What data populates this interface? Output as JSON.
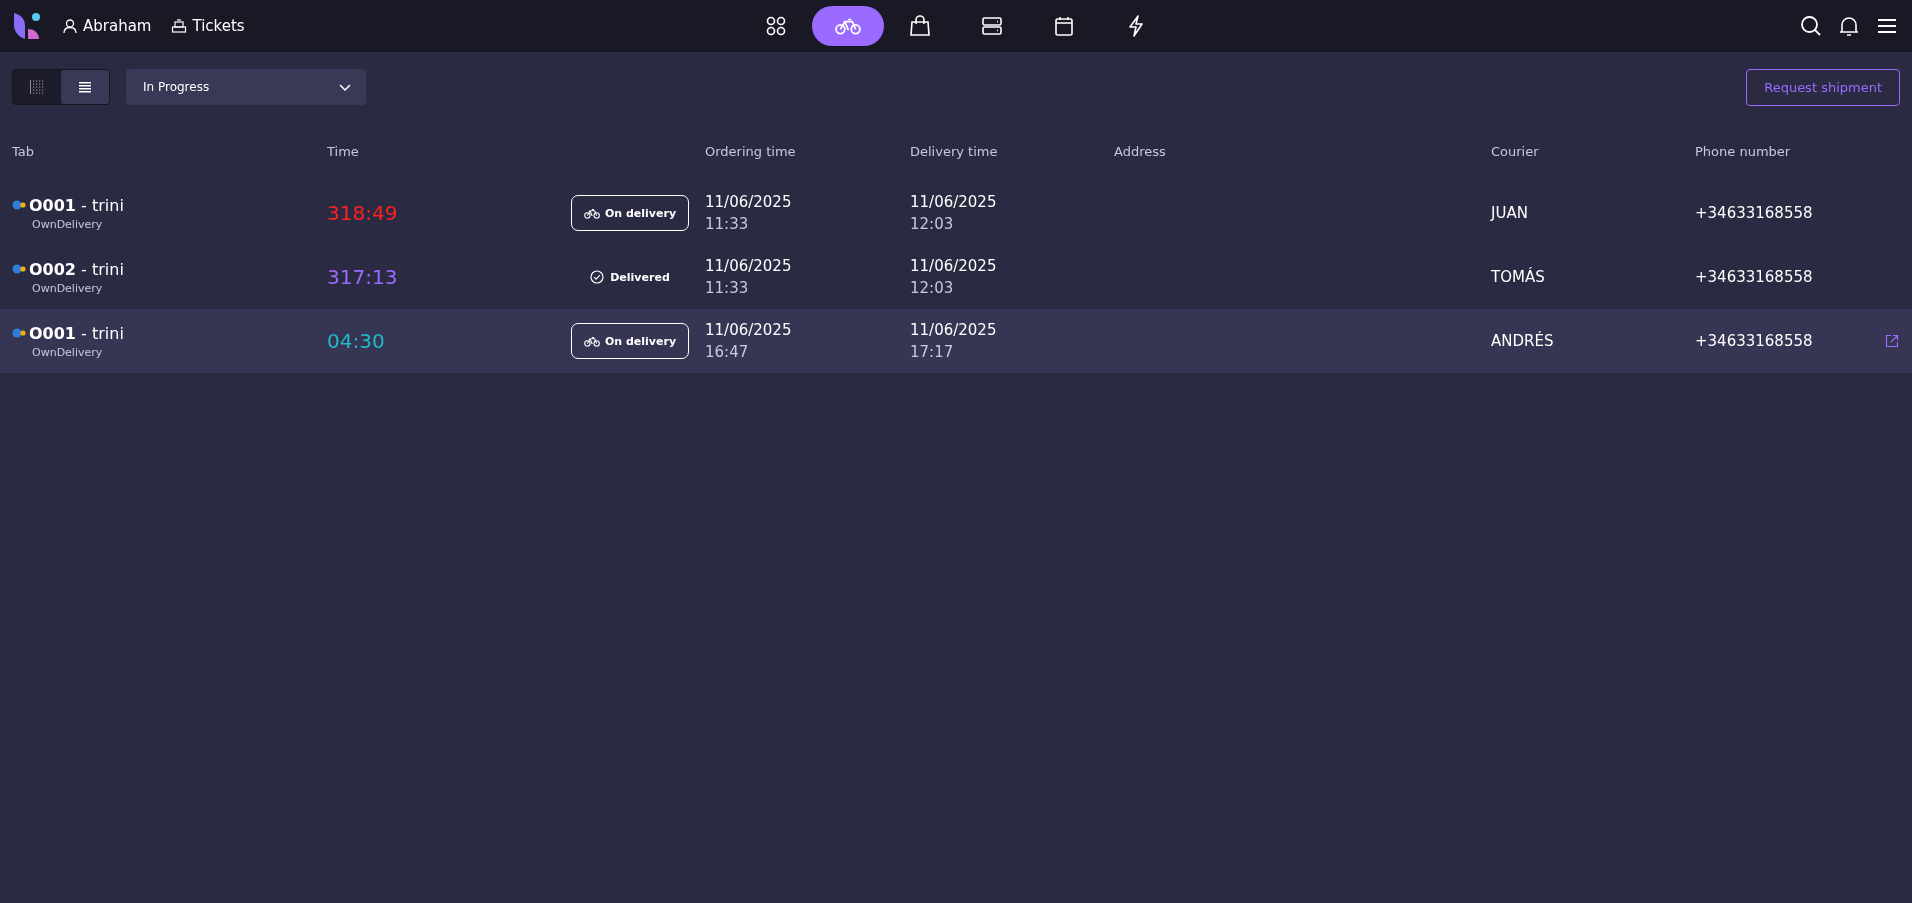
{
  "header": {
    "user": "Abraham",
    "section": "Tickets",
    "nav": [
      {
        "kind": "apps",
        "selected": false
      },
      {
        "kind": "bike",
        "selected": true
      },
      {
        "kind": "bag",
        "selected": false
      },
      {
        "kind": "server",
        "selected": false
      },
      {
        "kind": "calendar",
        "selected": false
      },
      {
        "kind": "bolt",
        "selected": false
      }
    ]
  },
  "toolbar": {
    "views": [
      {
        "kind": "grid",
        "selected": false
      },
      {
        "kind": "list",
        "selected": true
      }
    ],
    "filter": "In Progress",
    "action": "Request shipment"
  },
  "table": {
    "columns": [
      "Tab",
      "Time",
      "Ordering time",
      "Delivery time",
      "Address",
      "Courier",
      "Phone number"
    ],
    "rows": [
      {
        "title": "**O001** - trini",
        "channel": "OwnDelivery",
        "timer": "318:49",
        "color": "#ff2020",
        "status": {
          "kind": "on_delivery",
          "label": "On delivery"
        },
        "ordered_date": "11/06/2025",
        "ordered_time": "11:33",
        "delivery_date": "11/06/2025",
        "delivery_time": "12:03",
        "courier": "JUAN",
        "phone": "+34633168558",
        "highlighted": false
      },
      {
        "title": "**O002** - trini",
        "channel": "OwnDelivery",
        "timer": "317:13",
        "color": "#9b6bff",
        "status": {
          "kind": "delivered",
          "label": "Delivered"
        },
        "ordered_date": "11/06/2025",
        "ordered_time": "11:33",
        "delivery_date": "11/06/2025",
        "delivery_time": "12:03",
        "courier": "TOMÁS",
        "phone": "+34633168558",
        "highlighted": false
      },
      {
        "title": "**O001** - trini",
        "channel": "OwnDelivery",
        "timer": "04:30",
        "color": "#22b8c8",
        "status": {
          "kind": "on_delivery",
          "label": "On delivery"
        },
        "ordered_date": "11/06/2025",
        "ordered_time": "16:47",
        "delivery_date": "11/06/2025",
        "delivery_time": "17:17",
        "courier": "ANDRÉS",
        "phone": "+34633168558",
        "highlighted": true
      }
    ]
  }
}
